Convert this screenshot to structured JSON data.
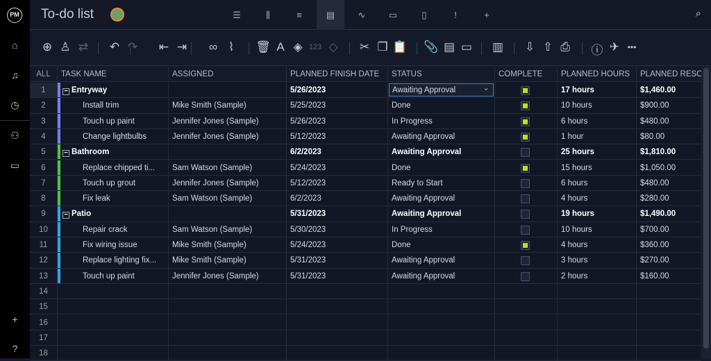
{
  "app": {
    "logo": "PM",
    "title": "To-do list"
  },
  "sidebar": [
    "home-icon",
    "bell-icon",
    "clock-icon",
    "users-icon",
    "briefcase-icon",
    "plus-icon",
    "help-icon"
  ],
  "views": [
    {
      "icon": "list-view-icon",
      "g": "☰"
    },
    {
      "icon": "board-view-icon",
      "g": "⫼"
    },
    {
      "icon": "gantt-view-icon",
      "g": "≡"
    },
    {
      "icon": "sheet-view-icon",
      "g": "▤",
      "active": true
    },
    {
      "icon": "dashboard-view-icon",
      "g": "∿"
    },
    {
      "icon": "calendar-view-icon",
      "g": "▭"
    },
    {
      "icon": "files-view-icon",
      "g": "▯"
    },
    {
      "icon": "issues-view-icon",
      "g": "!"
    },
    {
      "icon": "add-view-icon",
      "g": "+"
    }
  ],
  "columns": [
    "ALL",
    "TASK NAME",
    "ASSIGNED",
    "PLANNED FINISH DATE",
    "STATUS",
    "COMPLETE",
    "PLANNED HOURS",
    "PLANNED RESOU"
  ],
  "colors": {
    "Entryway": "#7b7cf0",
    "Bathroom": "#4fc24a",
    "Patio": "#3aa0e8",
    "check": "#b6e51a",
    "selected": "#4a7fc0"
  },
  "rows": [
    {
      "n": "1",
      "task": "Entryway",
      "group": true,
      "color": "Entryway",
      "assigned": "",
      "date": "5/26/2023",
      "status": "Awaiting Approval",
      "complete": true,
      "hours": "17 hours",
      "res": "$1,460.00",
      "selected": true
    },
    {
      "n": "2",
      "task": "Install trim",
      "color": "Entryway",
      "assigned": "Mike Smith (Sample)",
      "date": "5/25/2023",
      "status": "Done",
      "complete": true,
      "hours": "10 hours",
      "res": "$900.00"
    },
    {
      "n": "3",
      "task": "Touch up paint",
      "color": "Entryway",
      "assigned": "Jennifer Jones (Sample)",
      "date": "5/26/2023",
      "status": "In Progress",
      "complete": true,
      "hours": "6 hours",
      "res": "$480.00"
    },
    {
      "n": "4",
      "task": "Change lightbulbs",
      "color": "Entryway",
      "assigned": "Jennifer Jones (Sample)",
      "date": "5/12/2023",
      "status": "Awaiting Approval",
      "complete": true,
      "hours": "1 hour",
      "res": "$80.00"
    },
    {
      "n": "5",
      "task": "Bathroom",
      "group": true,
      "color": "Bathroom",
      "assigned": "",
      "date": "6/2/2023",
      "status": "Awaiting Approval",
      "complete": false,
      "hours": "25 hours",
      "res": "$1,810.00"
    },
    {
      "n": "6",
      "task": "Replace chipped ti...",
      "color": "Bathroom",
      "assigned": "Sam Watson (Sample)",
      "date": "5/24/2023",
      "status": "Done",
      "complete": true,
      "hours": "15 hours",
      "res": "$1,050.00"
    },
    {
      "n": "7",
      "task": "Touch up grout",
      "color": "Bathroom",
      "assigned": "Jennifer Jones (Sample)",
      "date": "5/12/2023",
      "status": "Ready to Start",
      "complete": false,
      "hours": "6 hours",
      "res": "$480.00"
    },
    {
      "n": "8",
      "task": "Fix leak",
      "color": "Bathroom",
      "assigned": "Sam Watson (Sample)",
      "date": "6/2/2023",
      "status": "Awaiting Approval",
      "complete": false,
      "hours": "4 hours",
      "res": "$280.00"
    },
    {
      "n": "9",
      "task": "Patio",
      "group": true,
      "color": "Patio",
      "assigned": "",
      "date": "5/31/2023",
      "status": "Awaiting Approval",
      "complete": false,
      "hours": "19 hours",
      "res": "$1,490.00"
    },
    {
      "n": "10",
      "task": "Repair crack",
      "color": "Patio",
      "assigned": "Sam Watson (Sample)",
      "date": "5/30/2023",
      "status": "In Progress",
      "complete": false,
      "hours": "10 hours",
      "res": "$700.00"
    },
    {
      "n": "11",
      "task": "Fix wiring issue",
      "color": "Patio",
      "assigned": "Mike Smith (Sample)",
      "date": "5/24/2023",
      "status": "Done",
      "complete": true,
      "hours": "4 hours",
      "res": "$360.00"
    },
    {
      "n": "12",
      "task": "Replace lighting fix...",
      "color": "Patio",
      "assigned": "Mike Smith (Sample)",
      "date": "5/31/2023",
      "status": "Awaiting Approval",
      "complete": false,
      "hours": "3 hours",
      "res": "$270.00"
    },
    {
      "n": "13",
      "task": "Touch up paint",
      "color": "Patio",
      "assigned": "Jennifer Jones (Sample)",
      "date": "5/31/2023",
      "status": "Awaiting Approval",
      "complete": false,
      "hours": "2 hours",
      "res": "$160.00"
    },
    {
      "n": "14"
    },
    {
      "n": "15"
    },
    {
      "n": "16"
    },
    {
      "n": "17"
    },
    {
      "n": "18"
    }
  ]
}
